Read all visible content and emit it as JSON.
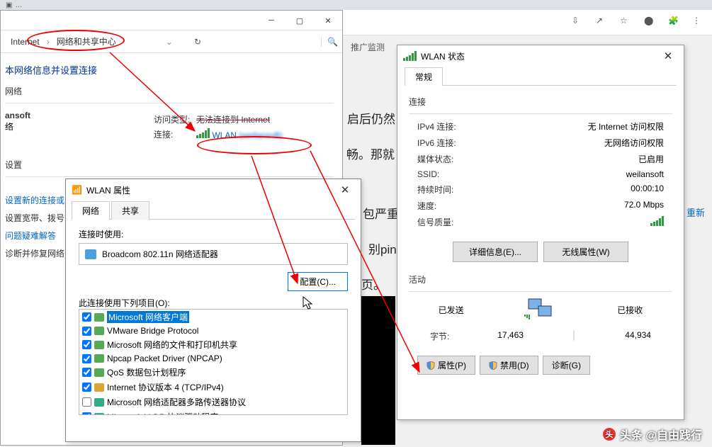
{
  "browser": {
    "share_icon": "↗",
    "star_icon": "☆",
    "puzzle_icon": "🧩",
    "refresh_link": "重新"
  },
  "netcenter": {
    "crumb1": "Internet",
    "crumb2": "网络和共享中心",
    "title": "本网络信息并设置连接",
    "section_networks": "网络",
    "net_name": "ansoft",
    "net_type": "络",
    "access_label": "访问类型:",
    "access_value": "无法连接到 Internet",
    "conn_label": "连接:",
    "conn_value": "WLAN",
    "conn_value_blur": "(weilansoft)",
    "section_settings": "设置",
    "side_new_conn": "设置新的连接或网",
    "side_bb": "设置宽带、拨号或",
    "side_trouble": "问题疑难解答",
    "side_diag": "诊断并修复网络问"
  },
  "wlanprop": {
    "title": "WLAN 属性",
    "tab_net": "网络",
    "tab_share": "共享",
    "connect_using": "连接时使用:",
    "adapter": "Broadcom 802.11n 网络适配器",
    "configure_btn": "配置(C)...",
    "items_label": "此连接使用下列项目(O):",
    "items": [
      {
        "checked": true,
        "label": "Microsoft 网络客户端",
        "sel": true
      },
      {
        "checked": true,
        "label": "VMware Bridge Protocol"
      },
      {
        "checked": true,
        "label": "Microsoft 网络的文件和打印机共享"
      },
      {
        "checked": true,
        "label": "Npcap Packet Driver (NPCAP)"
      },
      {
        "checked": true,
        "label": "QoS 数据包计划程序"
      },
      {
        "checked": true,
        "label": "Internet 协议版本 4 (TCP/IPv4)"
      },
      {
        "checked": false,
        "label": "Microsoft 网络适配器多路传送器协议"
      },
      {
        "checked": true,
        "label": "Microsoft LLDP 协议驱动程序"
      }
    ]
  },
  "wlanstat": {
    "title": "WLAN 状态",
    "tab_general": "常规",
    "grp_conn": "连接",
    "ipv4_k": "IPv4 连接:",
    "ipv4_v": "无 Internet 访问权限",
    "ipv6_k": "IPv6 连接:",
    "ipv6_v": "无网络访问权限",
    "media_k": "媒体状态:",
    "media_v": "已启用",
    "ssid_k": "SSID:",
    "ssid_v": "weilansoft",
    "dur_k": "持续时间:",
    "dur_v": "00:00:10",
    "speed_k": "速度:",
    "speed_v": "72.0 Mbps",
    "signal_k": "信号质量:",
    "btn_details": "详细信息(E)...",
    "btn_wprops": "无线属性(W)",
    "grp_activity": "活动",
    "sent": "已发送",
    "recv": "已接收",
    "bytes_k": "字节:",
    "bytes_sent": "17,463",
    "bytes_recv": "44,934",
    "btn_props": "属性(P)",
    "btn_disable": "禁用(D)",
    "btn_diag": "诊断(G)"
  },
  "bg": {
    "t1": "启后仍然",
    "t2": "畅。那就",
    "t3": "包严重",
    "t4": "别ping",
    "t5": "页。",
    "t6": "推广监测"
  },
  "watermark": "头条 @自由践行"
}
